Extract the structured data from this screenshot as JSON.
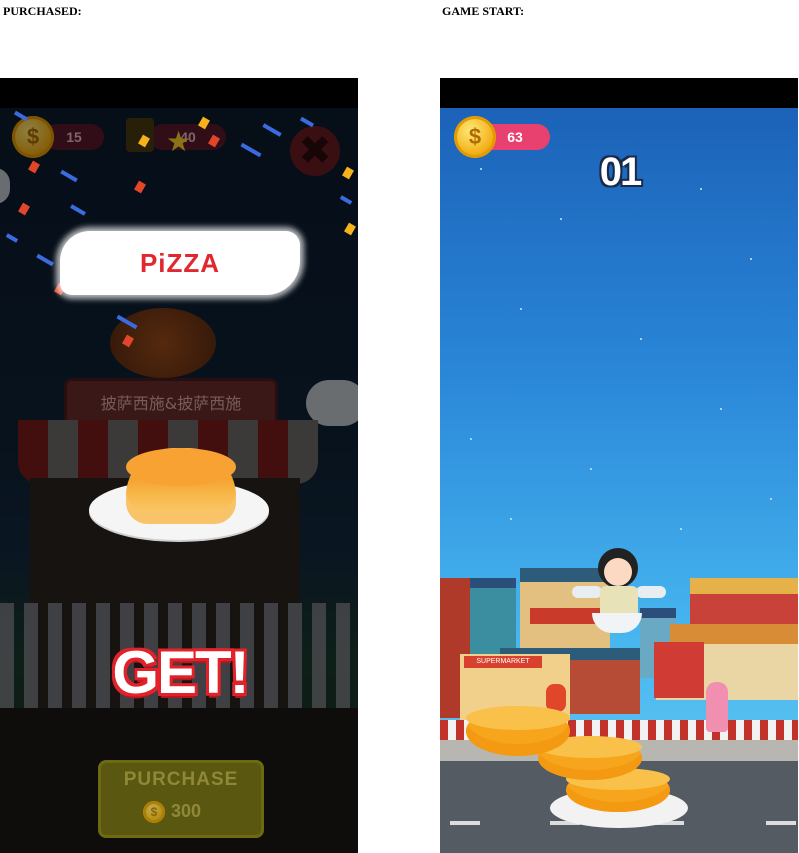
{
  "captions": {
    "left": "PURCHASED:",
    "right": "GAME START:"
  },
  "purchased_screen": {
    "hud": {
      "coins": "15",
      "stars": "40",
      "coin_icon": "dollar-coin-icon",
      "star_icon": "star-icon",
      "close_icon": "close-x-icon"
    },
    "item_title": "PiZZA",
    "stall_sign": "披萨西施&披萨西施",
    "get_label": "GET!",
    "purchase_button": {
      "label": "PURCHASE",
      "price": "300",
      "coin_icon": "dollar-coin-icon"
    },
    "colors": {
      "title_text": "#e0282e",
      "get_outline": "#e1222b",
      "purchase_bg": "#5a5810"
    }
  },
  "game_screen": {
    "hud": {
      "coins": "63",
      "coin_icon": "dollar-coin-icon"
    },
    "score": "01",
    "shop_sign": "SUPERMARKET",
    "colors": {
      "sky_top": "#1b62b8",
      "coin_pill": "#e84170"
    }
  }
}
